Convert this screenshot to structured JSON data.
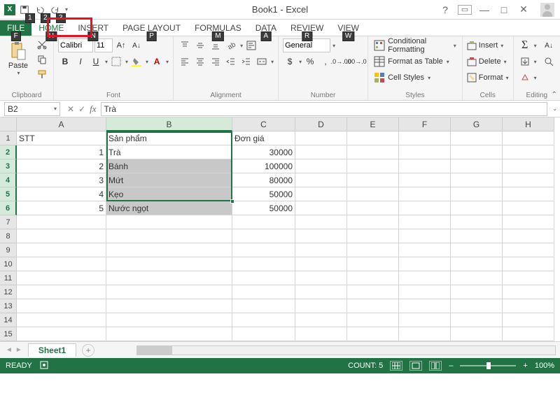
{
  "title": "Book1 - Excel",
  "qat_keys": [
    "1",
    "2",
    "3"
  ],
  "tabs": {
    "file": {
      "label": "FILE",
      "key": "F"
    },
    "home": {
      "label": "HOME",
      "key": "H"
    },
    "insert": {
      "label": "INSERT",
      "key": "N"
    },
    "pagelayout": {
      "label": "PAGE LAYOUT",
      "key": "P"
    },
    "formulas": {
      "label": "FORMULAS",
      "key": "M"
    },
    "data": {
      "label": "DATA",
      "key": "A"
    },
    "review": {
      "label": "REVIEW",
      "key": "R"
    },
    "view": {
      "label": "VIEW",
      "key": "W"
    }
  },
  "ribbon": {
    "clipboard": {
      "paste": "Paste",
      "label": "Clipboard"
    },
    "font": {
      "name": "Calibri",
      "size": "11",
      "label": "Font"
    },
    "alignment": {
      "label": "Alignment"
    },
    "number": {
      "format": "General",
      "label": "Number"
    },
    "styles": {
      "cf": "Conditional Formatting",
      "fat": "Format as Table",
      "cs": "Cell Styles",
      "label": "Styles"
    },
    "cells": {
      "insert": "Insert",
      "delete": "Delete",
      "format": "Format",
      "label": "Cells"
    },
    "editing": {
      "label": "Editing"
    }
  },
  "namebox": "B2",
  "formula": "Trà",
  "columns": [
    "A",
    "B",
    "C",
    "D",
    "E",
    "F",
    "G",
    "H"
  ],
  "grid": {
    "headers": {
      "a": "STT",
      "b": "Sản phẩm",
      "c": "Đơn giá"
    },
    "rows": [
      {
        "a": "1",
        "b": "Trà",
        "c": "30000"
      },
      {
        "a": "2",
        "b": "Bánh",
        "c": "100000"
      },
      {
        "a": "3",
        "b": "Mứt",
        "c": "80000"
      },
      {
        "a": "4",
        "b": "Kẹo",
        "c": "50000"
      },
      {
        "a": "5",
        "b": "Nước ngọt",
        "c": "50000"
      }
    ]
  },
  "sheet_tab": "Sheet1",
  "status": {
    "ready": "READY",
    "count_label": "COUNT:",
    "count": "5",
    "zoom": "100%"
  }
}
